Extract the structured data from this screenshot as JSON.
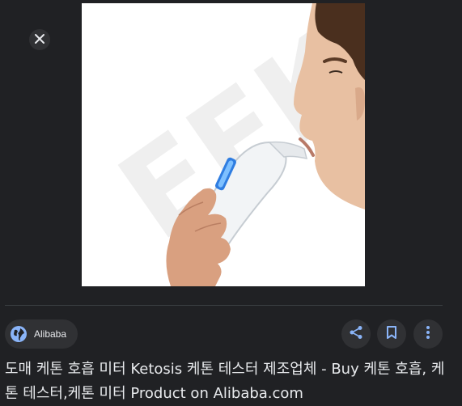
{
  "viewer": {
    "close_icon": "close-icon",
    "image_alt": "Man blowing into a white handheld ketone breath meter"
  },
  "source": {
    "name": "Alibaba",
    "icon": "globe-icon"
  },
  "actions": {
    "share_icon": "share-icon",
    "save_icon": "bookmark-icon",
    "more_icon": "more-vert-icon"
  },
  "title": "도매 케톤 호흡 미터 Ketosis 케톤 테스터 제조업체 - Buy 케톤 호흡, 케톤 테스터,케톤 미터 Product on Alibaba.com",
  "colors": {
    "background": "#202124",
    "chip": "#303134",
    "accent": "#8ab4f8",
    "text": "#e8eaed"
  }
}
